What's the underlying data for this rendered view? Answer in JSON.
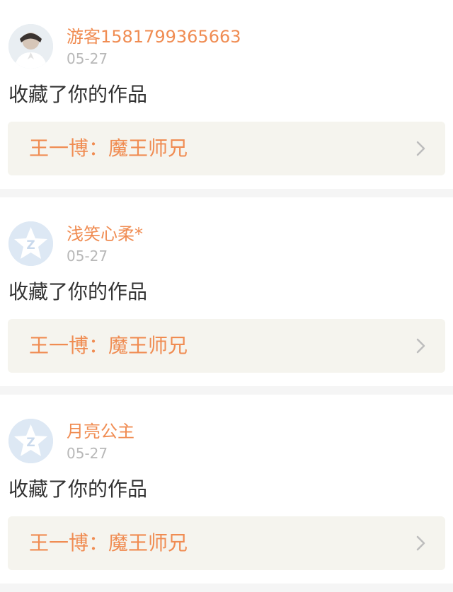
{
  "colors": {
    "accent": "#f08c52",
    "date": "#b8b8b8",
    "body_text": "#333333",
    "link_bg": "#f5f4ee",
    "divider": "#f5f5f5"
  },
  "items": [
    {
      "username": "游客1581799365663",
      "date": "05-27",
      "action": "收藏了你的作品",
      "work_title": "王一博：魔王师兄",
      "avatar": "user-photo-avatar-icon",
      "chevron": "chevron-right-icon"
    },
    {
      "username": "浅笑心柔*",
      "date": "05-27",
      "action": "收藏了你的作品",
      "work_title": "王一博：魔王师兄",
      "avatar": "default-star-avatar-icon",
      "chevron": "chevron-right-icon"
    },
    {
      "username": "月亮公主",
      "date": "05-27",
      "action": "收藏了你的作品",
      "work_title": "王一博：魔王师兄",
      "avatar": "default-star-avatar-icon",
      "chevron": "chevron-right-icon"
    }
  ]
}
